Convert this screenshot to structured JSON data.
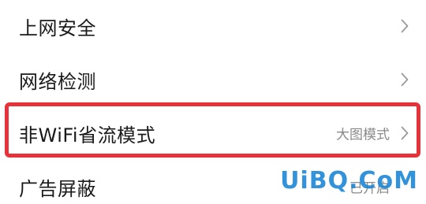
{
  "settings": {
    "items": [
      {
        "label": "上网安全",
        "value": ""
      },
      {
        "label": "网络检测",
        "value": ""
      },
      {
        "label": "非WiFi省流模式",
        "value": "大图模式"
      },
      {
        "label": "广告屏蔽",
        "value": "已开启"
      }
    ]
  },
  "watermark": "UiBQ.CoM",
  "colors": {
    "highlight": "#e8323a",
    "watermark": "#1e88d6",
    "value_text": "#8a8a8a"
  }
}
